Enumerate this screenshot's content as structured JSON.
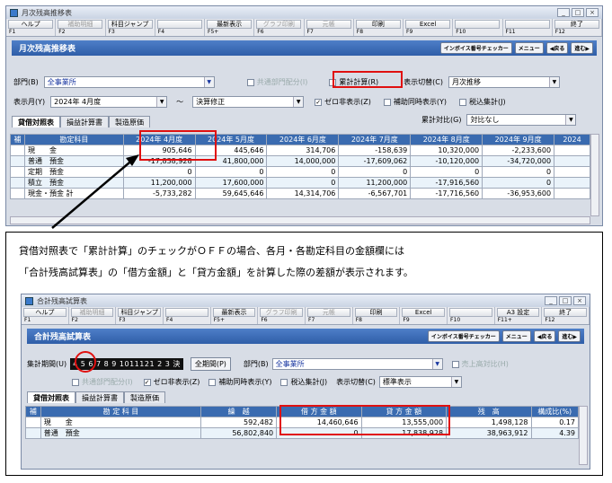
{
  "win1": {
    "title": "月次残高推移表",
    "fkeys": [
      {
        "label": "ヘルプ",
        "key": "F1"
      },
      {
        "label": "補助明細",
        "key": "F2",
        "disabled": true
      },
      {
        "label": "科目ジャンプ",
        "key": "F3"
      },
      {
        "label": "",
        "key": "F4"
      },
      {
        "label": "最新表示",
        "key": "F5+"
      },
      {
        "label": "グラフ印刷",
        "key": "F6",
        "disabled": true
      },
      {
        "label": "元帳",
        "key": "F7",
        "disabled": true
      },
      {
        "label": "印刷",
        "key": "F8"
      },
      {
        "label": "Excel",
        "key": "F9"
      },
      {
        "label": "",
        "key": "F10"
      },
      {
        "label": "",
        "key": "F11"
      },
      {
        "label": "終了",
        "key": "F12"
      }
    ],
    "banner": "月次残高推移表",
    "nav": [
      "インボイス番号チェッカー",
      "メニュー",
      "◀戻る",
      "進む▶"
    ],
    "dept_label": "部門(B)",
    "dept_value": "全事業所",
    "shared_label": "共通部門配分(I)",
    "cumulative_label": "累計計算(R)",
    "display_switch_label": "表示切替(C)",
    "display_switch_value": "月次推移",
    "month_label": "表示月(Y)",
    "month_from": "2024年 4月度",
    "tilde": "～",
    "month_to": "決算修正",
    "zero_hide_label": "ゼロ非表示(Z)",
    "sub_label": "補助同時表示(Y)",
    "tax_label": "税込集計(J)",
    "tabs": [
      "貸借対照表",
      "損益計算書",
      "製造原価"
    ],
    "compare_label": "累計対比(G)",
    "compare_value": "対比なし",
    "headers": [
      "補",
      "勘定科目",
      "2024年 4月度",
      "2024年 5月度",
      "2024年 6月度",
      "2024年 7月度",
      "2024年 8月度",
      "2024年 9月度",
      "2024"
    ],
    "rows": [
      [
        "",
        "現　　金",
        "905,646",
        "445,646",
        "314,706",
        "-158,639",
        "10,320,000",
        "-2,233,600"
      ],
      [
        "",
        "普通　預金",
        "-17,838,928",
        "41,800,000",
        "14,000,000",
        "-17,609,062",
        "-10,120,000",
        "-34,720,000"
      ],
      [
        "",
        "定期　預金",
        "0",
        "0",
        "0",
        "0",
        "0",
        "0"
      ],
      [
        "",
        "積立　預金",
        "11,200,000",
        "17,600,000",
        "0",
        "11,200,000",
        "-17,916,560",
        "0"
      ],
      [
        "",
        "現金・預金 計",
        "-5,733,282",
        "59,645,646",
        "14,314,706",
        "-6,567,701",
        "-17,716,560",
        "-36,953,600"
      ]
    ]
  },
  "note1": "貸借対照表で「累計計算」のチェックがＯＦＦの場合、各月・各勘定科目の金額欄には",
  "note2": "「合計残高試算表」の「借方金額」と「貸方金額」を計算した際の差額が表示されます。",
  "win2": {
    "title": "合計残高試算表",
    "fkeys": [
      {
        "label": "ヘルプ",
        "key": "F1"
      },
      {
        "label": "補助明細",
        "key": "F2",
        "disabled": true
      },
      {
        "label": "科目ジャンプ",
        "key": "F3"
      },
      {
        "label": "",
        "key": "F4"
      },
      {
        "label": "最新表示",
        "key": "F5+"
      },
      {
        "label": "グラフ印刷",
        "key": "F6",
        "disabled": true
      },
      {
        "label": "元帳",
        "key": "F7",
        "disabled": true
      },
      {
        "label": "印刷",
        "key": "F8"
      },
      {
        "label": "Excel",
        "key": "F9"
      },
      {
        "label": "",
        "key": "F10"
      },
      {
        "label": "A3 設定",
        "key": "F11+"
      },
      {
        "label": "終了",
        "key": "F12"
      }
    ],
    "banner": "合計残高試算表",
    "nav": [
      "インボイス番号チェッカー",
      "メニュー",
      "◀戻る",
      "進む▶"
    ],
    "period_label": "集計期間(U)",
    "period_months": "4 5 6 7 8 9 1011121 2 3 決",
    "all_period": "全期間(P)",
    "dept_label": "部門(B)",
    "dept_value": "全事業所",
    "sales_ratio": "売上高対比(H)",
    "shared_label": "共通部門配分(I)",
    "zero_hide_label": "ゼロ非表示(Z)",
    "sub_label": "補助同時表示(Y)",
    "tax_label": "税込集計(J)",
    "display_switch_label": "表示切替(C)",
    "display_switch_value": "標準表示",
    "tabs": [
      "貸借対照表",
      "損益計算書",
      "製造原価"
    ],
    "headers": [
      "補",
      "勘 定 科 目",
      "繰　越",
      "借 方 金 額",
      "貸 方 金 額",
      "残　高",
      "構成比(%)"
    ],
    "rows": [
      [
        "",
        "現　　金",
        "592,482",
        "14,460,646",
        "13,555,000",
        "1,498,128",
        "0.17"
      ],
      [
        "",
        "普通　預金",
        "56,802,840",
        "0",
        "17,838,928",
        "38,963,912",
        "4.39"
      ]
    ]
  }
}
